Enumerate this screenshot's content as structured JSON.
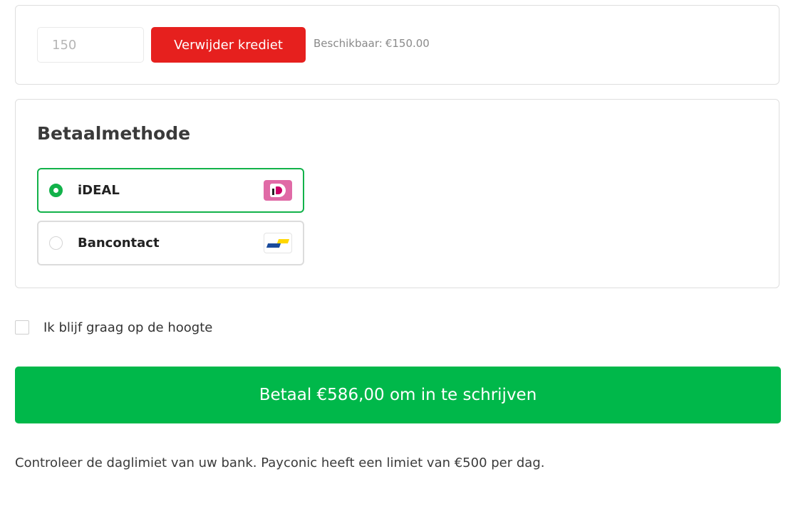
{
  "credit": {
    "input_placeholder": "150",
    "remove_label": "Verwijder krediet",
    "available_label": "Beschikbaar:",
    "available_amount": "€150.00"
  },
  "payment": {
    "title": "Betaalmethode",
    "selected": "ideal",
    "methods": [
      {
        "id": "ideal",
        "label": "iDEAL",
        "logo": "ideal-logo-icon",
        "selected": true
      },
      {
        "id": "bancontact",
        "label": "Bancontact",
        "logo": "bancontact-logo-icon",
        "selected": false
      }
    ]
  },
  "newsletter": {
    "label": "Ik blijf graag op de hoogte",
    "checked": false
  },
  "pay_button": {
    "label": "Betaal €586,00 om in te schrijven"
  },
  "limit_note": "Controleer de daglimiet van uw bank. Payconic heeft een limiet van €500 per dag.",
  "colors": {
    "remove_button": "#e6201e",
    "pay_button": "#00b84a",
    "selected_border": "#12b24a",
    "ideal_logo": "#e06aa6"
  }
}
